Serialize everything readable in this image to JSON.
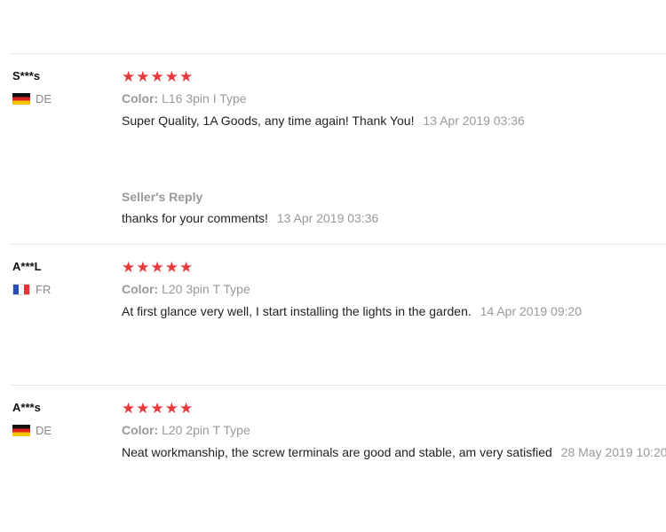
{
  "reviews": [
    {
      "user": "S***s",
      "country": "DE",
      "stars": 5,
      "sku_label": "Color:",
      "sku_value": "L16 3pin I Type",
      "text": "Super Quality, 1A Goods, any time again! Thank You!",
      "time": "13 Apr 2019 03:36",
      "reply": {
        "title": "Seller's Reply",
        "text": "thanks for your comments!",
        "time": "13 Apr 2019 03:36"
      }
    },
    {
      "user": "A***L",
      "country": "FR",
      "stars": 5,
      "sku_label": "Color:",
      "sku_value": "L20 3pin T Type",
      "text": "At first glance very well, I start installing the lights in the garden.",
      "time": "14 Apr 2019 09:20"
    },
    {
      "user": "A***s",
      "country": "DE",
      "stars": 5,
      "sku_label": "Color:",
      "sku_value": "L20 2pin T Type",
      "text": "Neat workmanship, the screw terminals are good and stable, am very satisfied",
      "time": "28 May 2019 10:20"
    }
  ],
  "colors": {
    "star": "#e8393c",
    "muted": "#999999",
    "text": "#222222"
  },
  "icons": {
    "star": "star-icon",
    "flag_de": "germany-flag-icon",
    "flag_fr": "france-flag-icon"
  }
}
